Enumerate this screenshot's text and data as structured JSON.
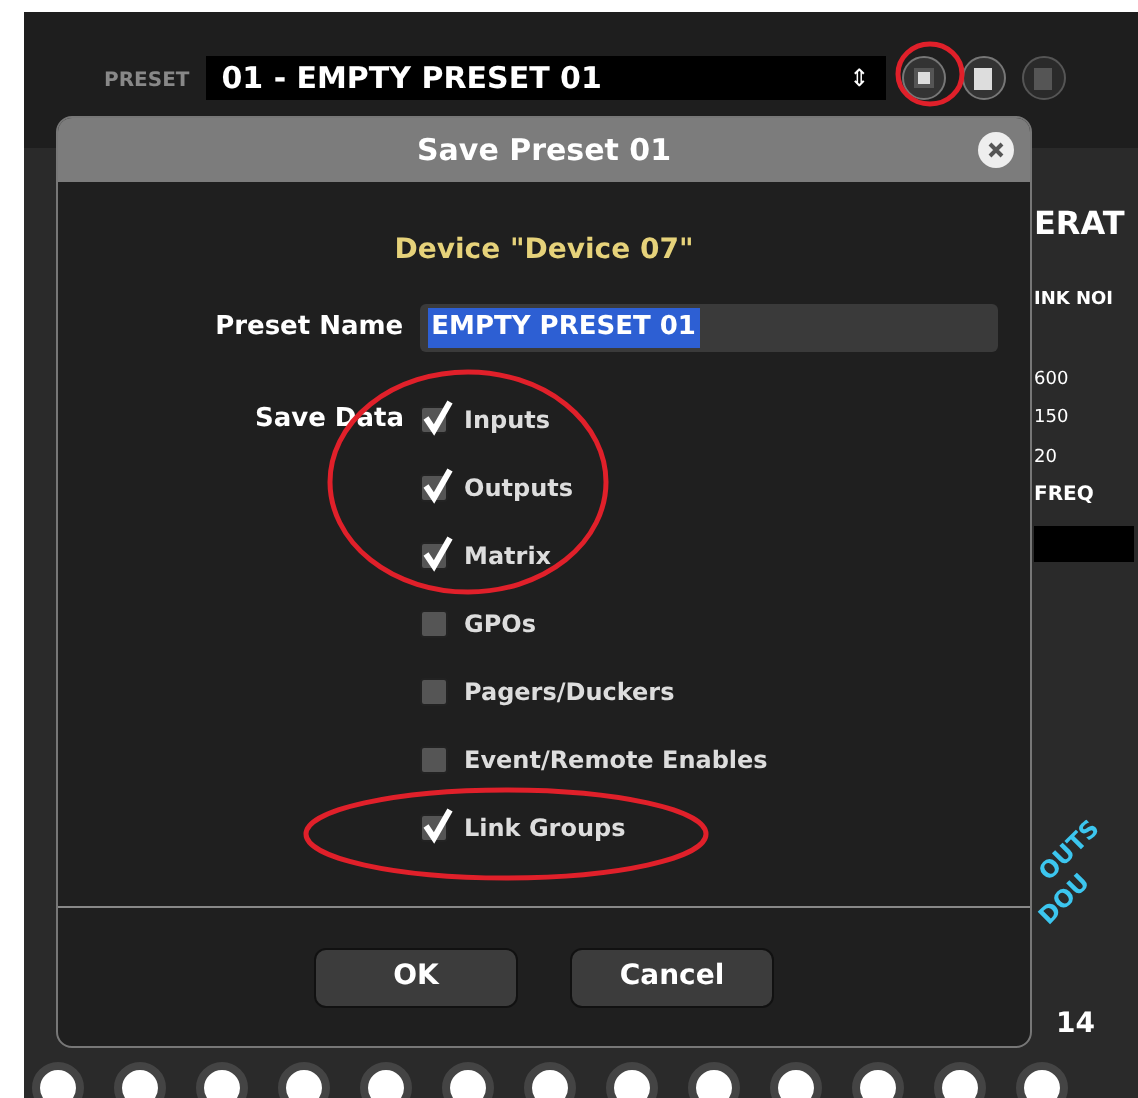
{
  "toolbar": {
    "preset_label": "PRESET",
    "preset_value": "01 - EMPTY PRESET 01",
    "spinner": "⇕"
  },
  "background": {
    "heading": "ERAT",
    "signal_value": "INK NOI",
    "freq_ticks": [
      "600",
      "150",
      "20"
    ],
    "freq_label": "FREQ",
    "diagonal_labels": [
      "OUTS",
      "DOU"
    ],
    "channel_number": "14"
  },
  "dialog": {
    "title": "Save Preset 01",
    "device": "Device \"Device 07\"",
    "preset_name_label": "Preset Name",
    "preset_name_value": "EMPTY PRESET 01",
    "save_data_label": "Save Data",
    "options": [
      {
        "label": "Inputs",
        "checked": true
      },
      {
        "label": "Outputs",
        "checked": true
      },
      {
        "label": "Matrix",
        "checked": true
      },
      {
        "label": "GPOs",
        "checked": false
      },
      {
        "label": "Pagers/Duckers",
        "checked": false
      },
      {
        "label": "Event/Remote Enables",
        "checked": false
      },
      {
        "label": "Link Groups",
        "checked": true
      }
    ],
    "buttons": [
      "OK",
      "Cancel"
    ]
  }
}
